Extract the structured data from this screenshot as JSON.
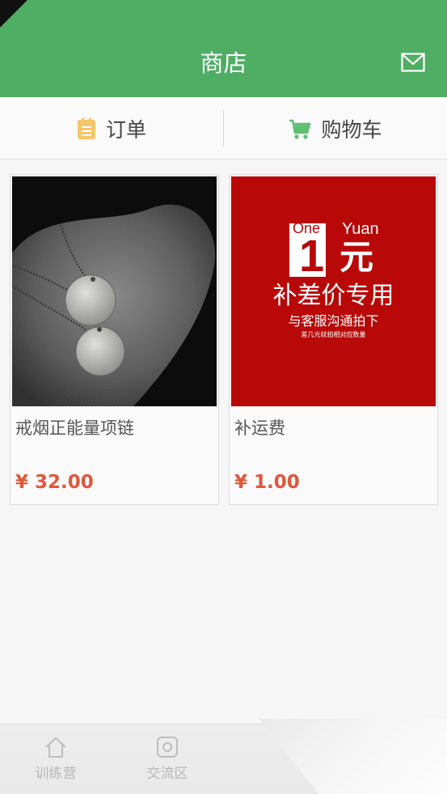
{
  "header": {
    "title": "商店",
    "mail_icon": "mail-icon",
    "bg_color": "#4fad64"
  },
  "tabs": [
    {
      "label": "订单",
      "icon": "clipboard-icon"
    },
    {
      "label": "购物车",
      "icon": "shopping-cart-icon"
    }
  ],
  "products": [
    {
      "name": "戒烟正能量项链",
      "price": "¥ 32.00",
      "image": "necklace-photo"
    },
    {
      "name": "补运费",
      "price": "¥ 1.00",
      "image": {
        "one_en": "One",
        "one_digit": "1",
        "yuan_en": "Yuan",
        "yuan_cn": "元",
        "line1": "补差价专用",
        "line2": "与客服沟通拍下",
        "line3": "差几元就拍相对应数量"
      }
    }
  ],
  "bottom_nav": [
    {
      "label": "训练营",
      "icon": "home-icon"
    },
    {
      "label": "交流区",
      "icon": "camera-icon"
    }
  ],
  "colors": {
    "price": "#e0573b",
    "accent": "#4fad64"
  }
}
